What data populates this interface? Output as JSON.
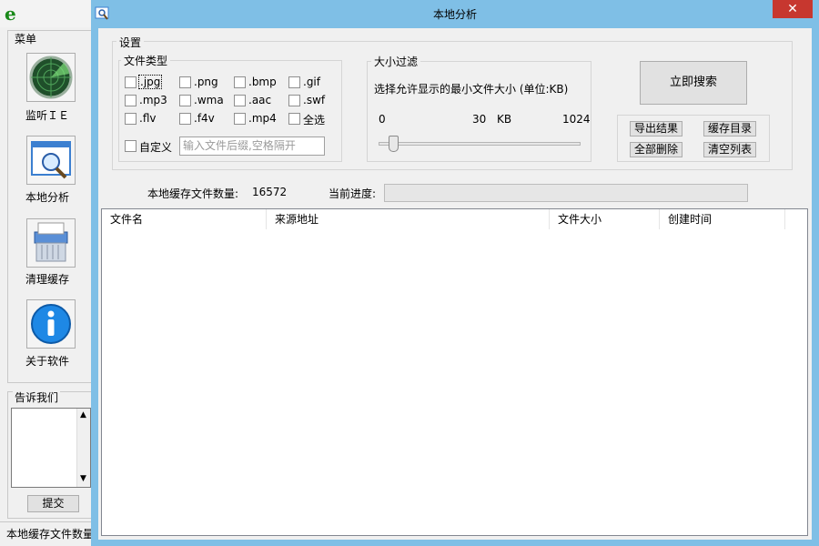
{
  "back_window": {
    "menu_title": "菜单",
    "menu_items": [
      {
        "label": "监听ＩＥ",
        "icon": "radar-icon"
      },
      {
        "label": "本地分析",
        "icon": "magnifier-window-icon"
      },
      {
        "label": "清理缓存",
        "icon": "shredder-icon"
      },
      {
        "label": "关于软件",
        "icon": "info-icon"
      }
    ],
    "tell_us_title": "告诉我们",
    "feedback_value": "",
    "submit_label": "提交",
    "status_text": "本地缓存文件数量"
  },
  "dialog": {
    "title": "本地分析",
    "settings_title": "设置",
    "file_types": {
      "title": "文件类型",
      "options": [
        {
          "label": ".jpg",
          "checked": false
        },
        {
          "label": ".png",
          "checked": false
        },
        {
          "label": ".bmp",
          "checked": false
        },
        {
          "label": ".gif",
          "checked": false
        },
        {
          "label": ".mp3",
          "checked": false
        },
        {
          "label": ".wma",
          "checked": false
        },
        {
          "label": ".aac",
          "checked": false
        },
        {
          "label": ".swf",
          "checked": false
        },
        {
          "label": ".flv",
          "checked": false
        },
        {
          "label": ".f4v",
          "checked": false
        },
        {
          "label": ".mp4",
          "checked": false
        },
        {
          "label": "全选",
          "checked": false
        }
      ],
      "custom_label": "自定义",
      "custom_placeholder": "输入文件后缀,空格隔开"
    },
    "size_filter": {
      "title": "大小过滤",
      "description": "选择允许显示的最小文件大小 (单位:KB)",
      "min": "0",
      "current": "30",
      "unit": "KB",
      "max": "1024",
      "slider_value": 30
    },
    "search_label": "立即搜索",
    "buttons": {
      "export": "导出结果",
      "cache_dir": "缓存目录",
      "delete_all": "全部删除",
      "clear_list": "清空列表"
    },
    "stats": {
      "count_label": "本地缓存文件数量:",
      "count_value": "16572",
      "progress_label": "当前进度:",
      "progress": 0
    },
    "columns": [
      "文件名",
      "来源地址",
      "文件大小",
      "创建时间"
    ],
    "rows": []
  },
  "colors": {
    "dialog_frame": "#7fbfe6",
    "close_button": "#c7372f",
    "logo": "#1a8a1a"
  }
}
